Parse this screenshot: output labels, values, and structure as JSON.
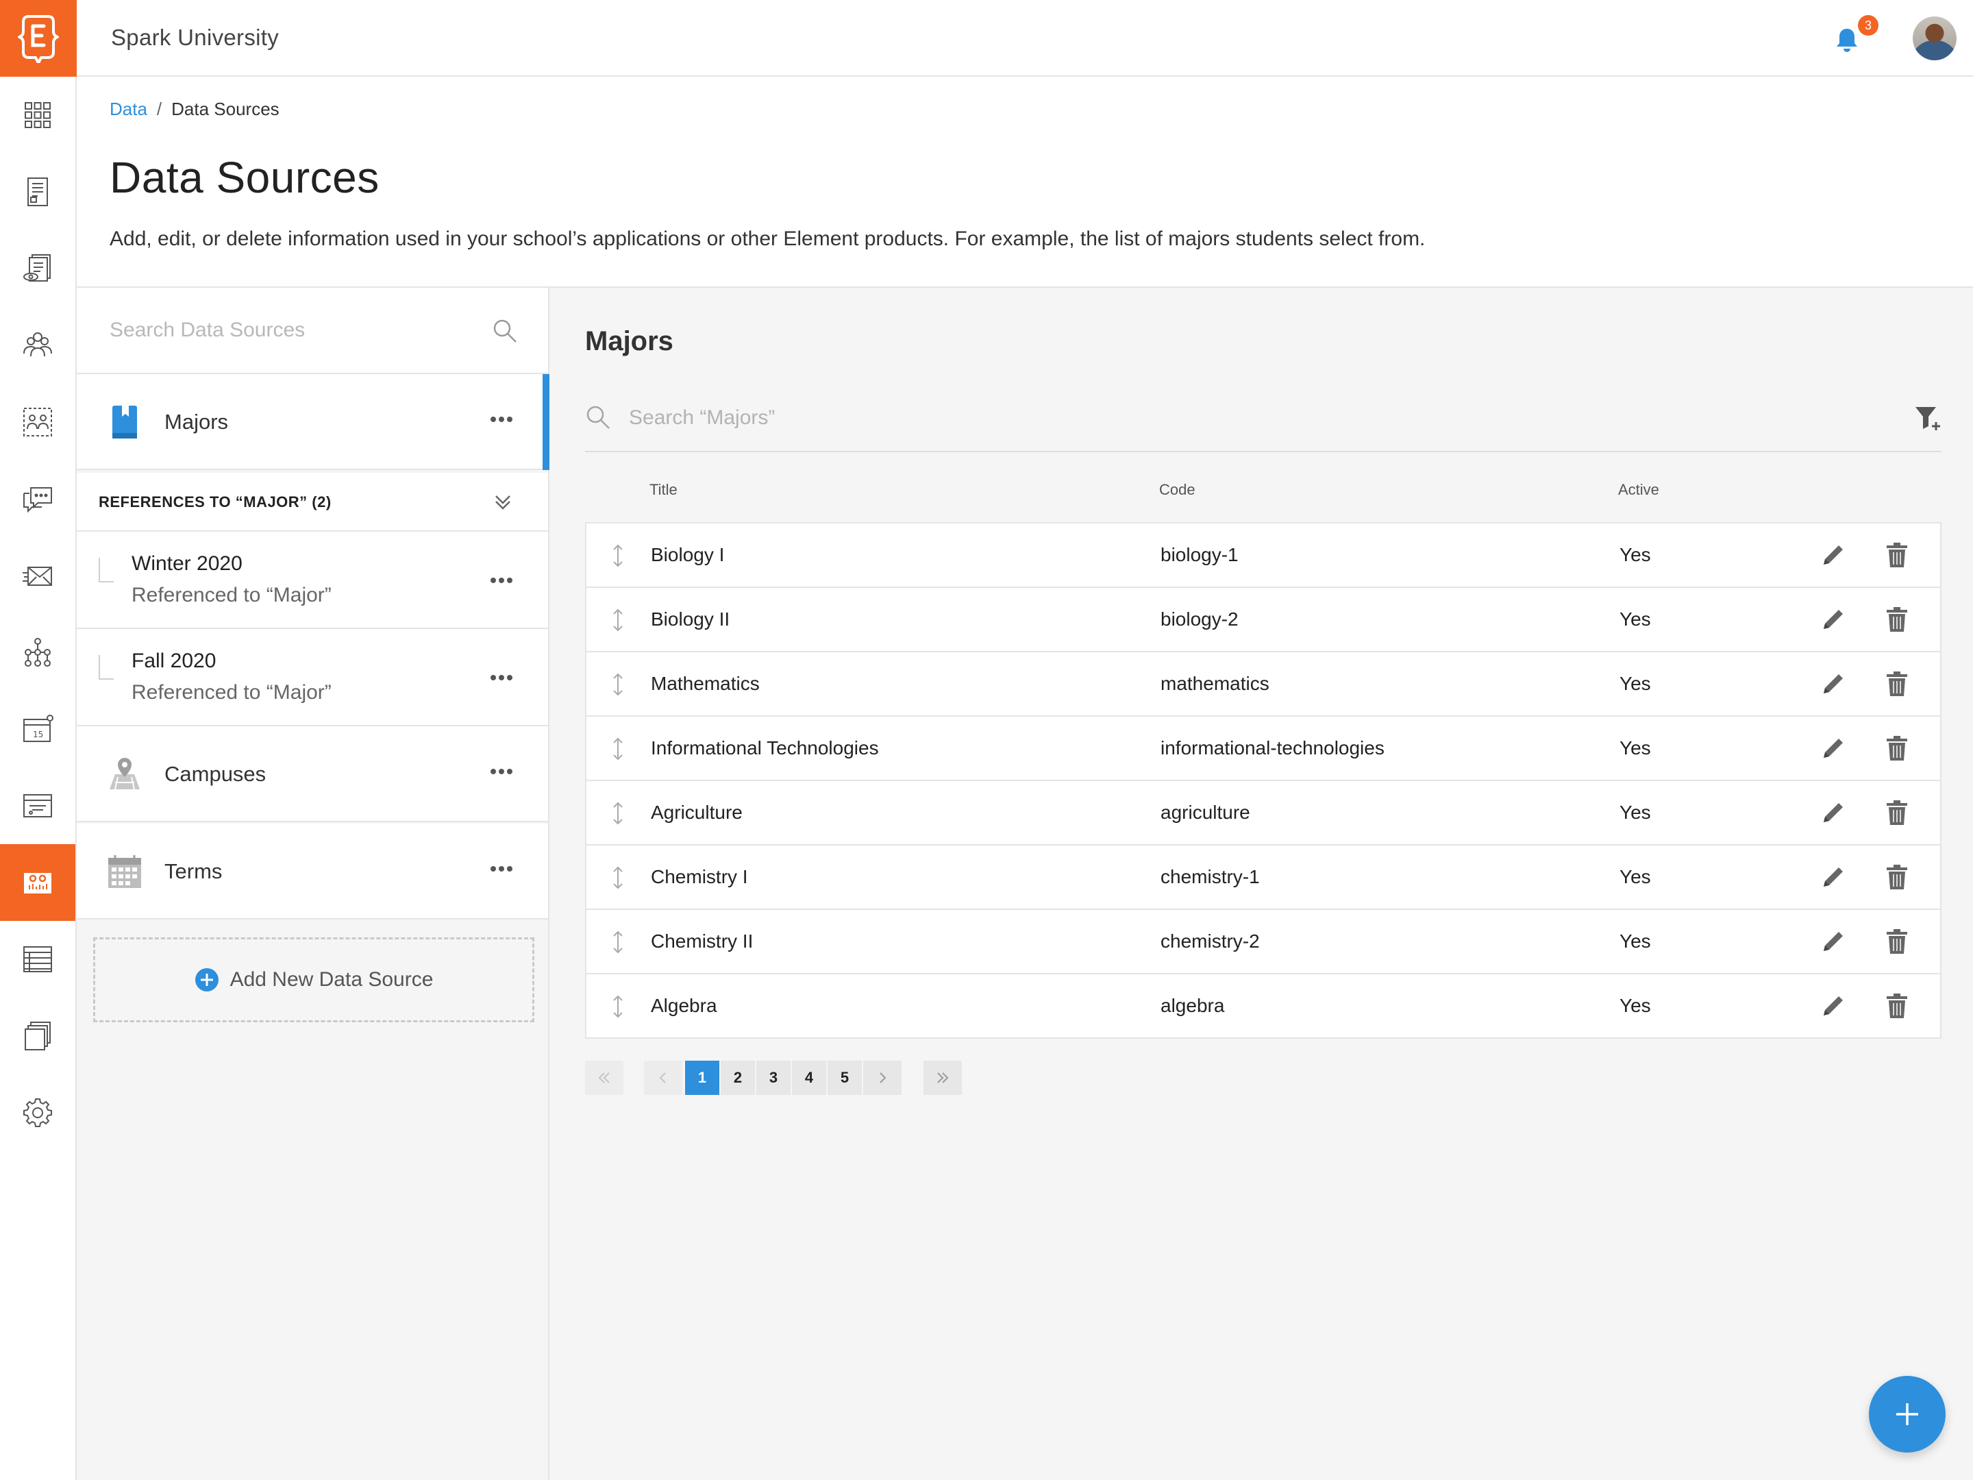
{
  "app": {
    "org_name": "Spark University",
    "notification_count": "3",
    "accent": "#f26522",
    "primary": "#2e8fdc"
  },
  "rail": {
    "items": [
      {
        "icon": "apps-grid-icon"
      },
      {
        "icon": "form-icon"
      },
      {
        "icon": "review-icon"
      },
      {
        "icon": "people-icon"
      },
      {
        "icon": "groups-icon"
      },
      {
        "icon": "chat-icon"
      },
      {
        "icon": "mail-icon"
      },
      {
        "icon": "workflow-icon"
      },
      {
        "icon": "calendar-icon"
      },
      {
        "icon": "filter-box-icon"
      },
      {
        "icon": "data-sources-icon",
        "active": true
      },
      {
        "icon": "spreadsheet-icon"
      },
      {
        "icon": "documents-icon"
      },
      {
        "icon": "settings-gear-icon"
      }
    ]
  },
  "breadcrumb": {
    "root": "Data",
    "separator": "/",
    "current": "Data Sources"
  },
  "page": {
    "title": "Data Sources",
    "description": "Add, edit, or delete information used in your school’s applications or other Element products. For example, the list of majors students select from."
  },
  "sources": {
    "search_placeholder": "Search Data Sources",
    "selected": {
      "label": "Majors",
      "icon": "book-icon"
    },
    "refs_header": "REFERENCES TO “MAJOR” (2)",
    "references": [
      {
        "title": "Winter 2020",
        "subtitle": "Referenced to “Major”"
      },
      {
        "title": "Fall 2020",
        "subtitle": "Referenced to “Major”"
      }
    ],
    "others": [
      {
        "label": "Campuses",
        "icon": "campus-map-icon"
      },
      {
        "label": "Terms",
        "icon": "calendar-grid-icon"
      }
    ],
    "add_label": "Add New Data Source"
  },
  "main": {
    "title": "Majors",
    "search_placeholder": "Search “Majors”",
    "columns": {
      "title": "Title",
      "code": "Code",
      "active": "Active"
    },
    "rows": [
      {
        "title": "Biology I",
        "code": "biology-1",
        "active": "Yes"
      },
      {
        "title": "Biology II",
        "code": "biology-2",
        "active": "Yes"
      },
      {
        "title": "Mathematics",
        "code": "mathematics",
        "active": "Yes"
      },
      {
        "title": "Informational Technologies",
        "code": "informational-technologies",
        "active": "Yes"
      },
      {
        "title": "Agriculture",
        "code": "agriculture",
        "active": "Yes"
      },
      {
        "title": "Chemistry I",
        "code": "chemistry-1",
        "active": "Yes"
      },
      {
        "title": "Chemistry II",
        "code": "chemistry-2",
        "active": "Yes"
      },
      {
        "title": "Algebra",
        "code": "algebra",
        "active": "Yes"
      }
    ],
    "pagination": {
      "pages": [
        "1",
        "2",
        "3",
        "4",
        "5"
      ],
      "current": "1"
    }
  }
}
